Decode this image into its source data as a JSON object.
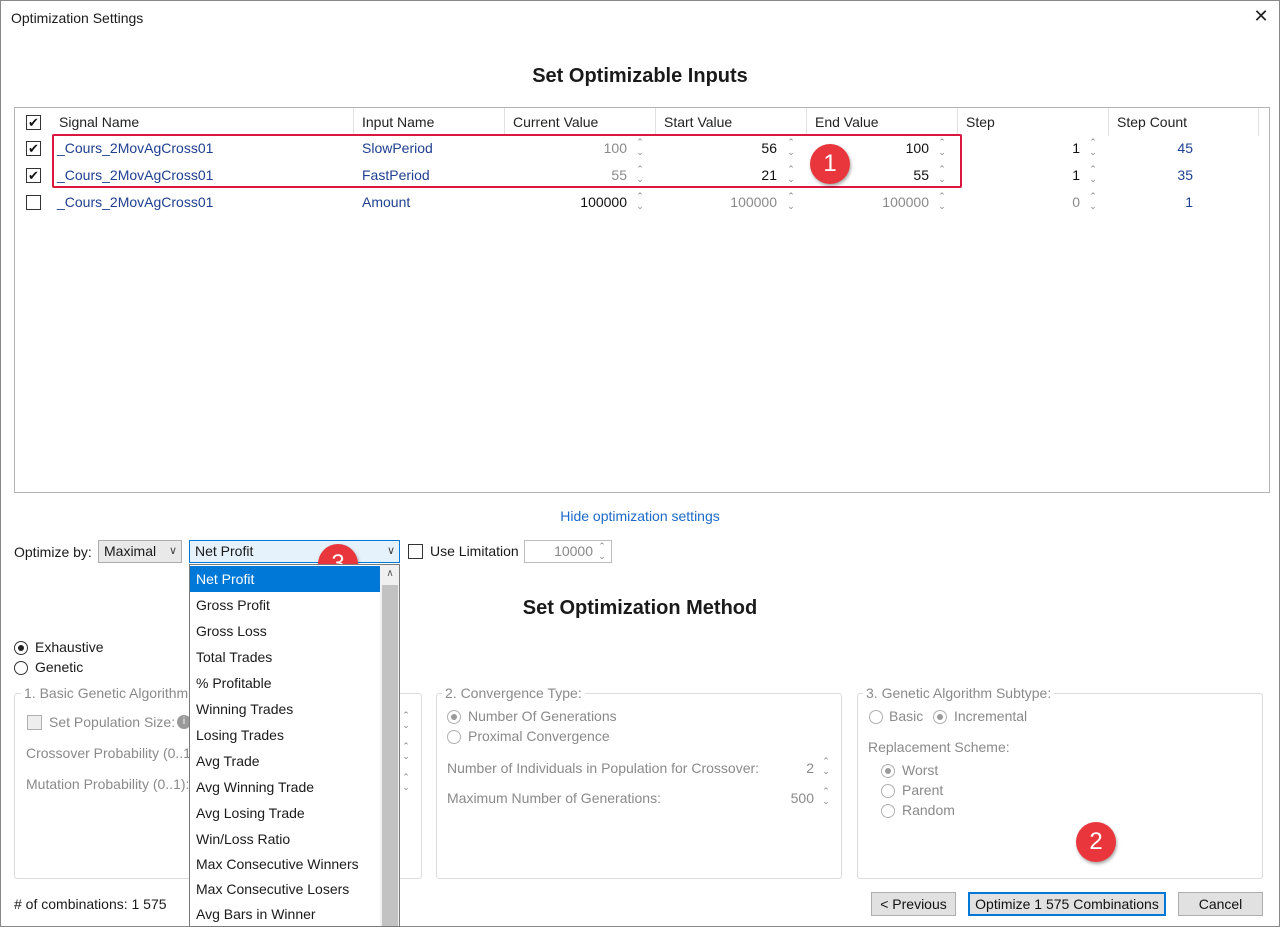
{
  "window": {
    "title": "Optimization Settings"
  },
  "inputs_heading": "Set Optimizable Inputs",
  "grid": {
    "columns": [
      "Signal Name",
      "Input Name",
      "Current Value",
      "Start Value",
      "End Value",
      "Step",
      "Step Count"
    ],
    "rows": [
      {
        "checked": true,
        "signal": "_Cours_2MovAgCross01",
        "input": "SlowPeriod",
        "current": "100",
        "start": "56",
        "end": "100",
        "step": "1",
        "count": "45"
      },
      {
        "checked": true,
        "signal": "_Cours_2MovAgCross01",
        "input": "FastPeriod",
        "current": "55",
        "start": "21",
        "end": "55",
        "step": "1",
        "count": "35"
      },
      {
        "checked": false,
        "signal": "_Cours_2MovAgCross01",
        "input": "Amount",
        "current": "100000",
        "start": "100000",
        "end": "100000",
        "step": "0",
        "count": "1"
      }
    ]
  },
  "badges": [
    "1",
    "2",
    "3"
  ],
  "hide_link": "Hide optimization settings",
  "optimize": {
    "label": "Optimize by:",
    "mode": "Maximal",
    "criterion": "Net Profit",
    "use_limitation_label": "Use Limitation",
    "limitation_value": "10000"
  },
  "dropdown_items": [
    "Net Profit",
    "Gross Profit",
    "Gross Loss",
    "Total Trades",
    "% Profitable",
    "Winning Trades",
    "Losing Trades",
    "Avg Trade",
    "Avg Winning Trade",
    "Avg Losing Trade",
    "Win/Loss Ratio",
    "Max Consecutive Winners",
    "Max Consecutive Losers",
    "Avg Bars in Winner"
  ],
  "method_heading": "Set Optimization Method",
  "method": {
    "exhaustive": "Exhaustive",
    "genetic": "Genetic"
  },
  "group1": {
    "title": "1. Basic Genetic Algorithm",
    "population": "Set Population Size:",
    "crossover": "Crossover Probability (0..1)",
    "mutation": "Mutation Probability (0..1):"
  },
  "group2": {
    "title": "2. Convergence Type:",
    "generations": "Number Of Generations",
    "proximal": "Proximal Convergence",
    "individuals_label": "Number of Individuals in Population for Crossover:",
    "individuals_value": "2",
    "max_gen_label": "Maximum Number of Generations:",
    "max_gen_value": "500"
  },
  "group3": {
    "title": "3. Genetic Algorithm Subtype:",
    "basic": "Basic",
    "incremental": "Incremental",
    "replacement_label": "Replacement Scheme:",
    "worst": "Worst",
    "parent": "Parent",
    "random": "Random"
  },
  "footer": {
    "combinations": "# of combinations: 1 575",
    "previous": "< Previous",
    "optimize": "Optimize 1 575 Combinations",
    "cancel": "Cancel"
  }
}
